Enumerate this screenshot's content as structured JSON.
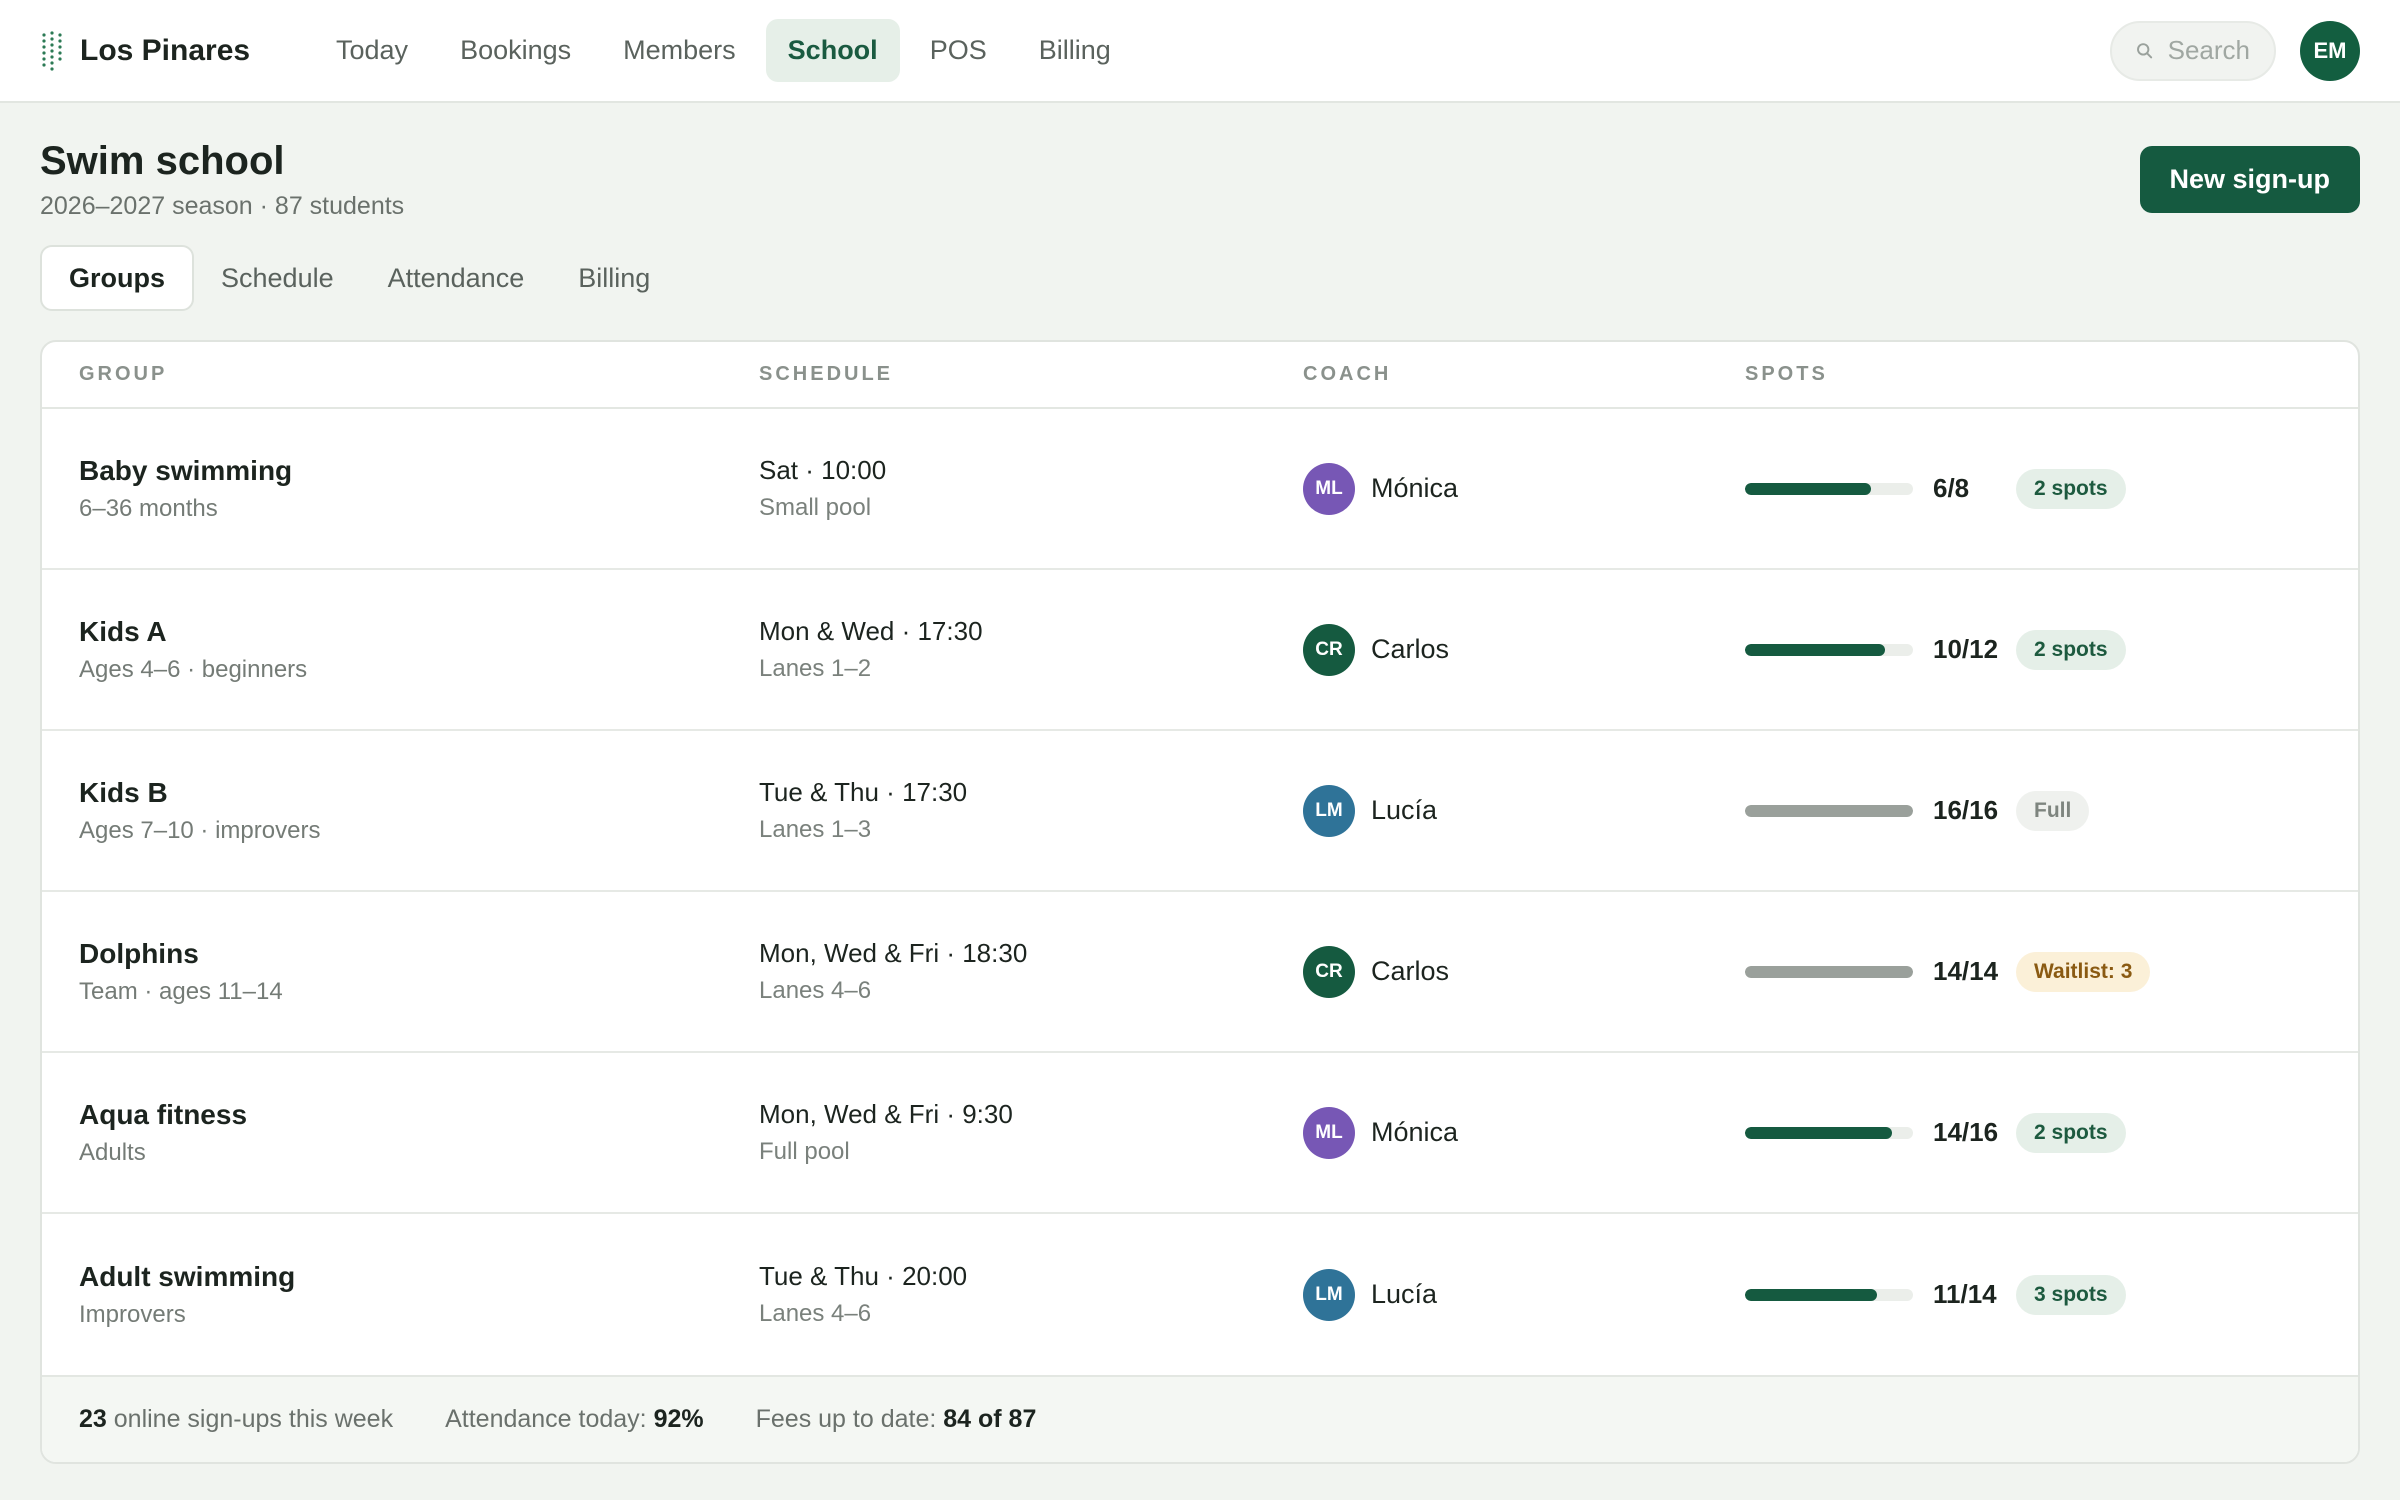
{
  "app": {
    "name": "Los Pinares"
  },
  "nav": {
    "items": [
      {
        "label": "Today"
      },
      {
        "label": "Bookings"
      },
      {
        "label": "Members"
      },
      {
        "label": "School",
        "active": true
      },
      {
        "label": "POS"
      },
      {
        "label": "Billing"
      }
    ]
  },
  "search": {
    "placeholder": "Search"
  },
  "user": {
    "initials": "EM"
  },
  "page": {
    "title": "Swim school",
    "subtitle": "2026–2027 season · 87 students",
    "new_button": "New sign-up"
  },
  "tabs": [
    {
      "label": "Groups",
      "active": true
    },
    {
      "label": "Schedule"
    },
    {
      "label": "Attendance"
    },
    {
      "label": "Billing"
    }
  ],
  "table": {
    "headers": {
      "group": "GROUP",
      "schedule": "SCHEDULE",
      "coach": "COACH",
      "spots": "SPOTS"
    },
    "rows": [
      {
        "name": "Baby swimming",
        "detail": "6–36 months",
        "schedule": "Sat · 10:00",
        "location": "Small pool",
        "coach": {
          "initials": "ML",
          "name": "Mónica",
          "color": "#7757b5"
        },
        "spots": "6/8",
        "fill": 0.75,
        "bar_color": "#155a40",
        "badge": "2 spots",
        "status": "open"
      },
      {
        "name": "Kids A",
        "detail": "Ages 4–6 · beginners",
        "schedule": "Mon & Wed · 17:30",
        "location": "Lanes 1–2",
        "coach": {
          "initials": "CR",
          "name": "Carlos",
          "color": "#155a40"
        },
        "spots": "10/12",
        "fill": 0.833,
        "bar_color": "#155a40",
        "badge": "2 spots",
        "status": "open"
      },
      {
        "name": "Kids B",
        "detail": "Ages 7–10 · improvers",
        "schedule": "Tue & Thu · 17:30",
        "location": "Lanes 1–3",
        "coach": {
          "initials": "LM",
          "name": "Lucía",
          "color": "#2f7398"
        },
        "spots": "16/16",
        "fill": 1.0,
        "bar_color": "#9aa09b",
        "badge": "Full",
        "status": "full"
      },
      {
        "name": "Dolphins",
        "detail": "Team · ages 11–14",
        "schedule": "Mon, Wed & Fri · 18:30",
        "location": "Lanes 4–6",
        "coach": {
          "initials": "CR",
          "name": "Carlos",
          "color": "#155a40"
        },
        "spots": "14/14",
        "fill": 1.0,
        "bar_color": "#9aa09b",
        "badge": "Waitlist: 3",
        "status": "wait"
      },
      {
        "name": "Aqua fitness",
        "detail": "Adults",
        "schedule": "Mon, Wed & Fri · 9:30",
        "location": "Full pool",
        "coach": {
          "initials": "ML",
          "name": "Mónica",
          "color": "#7757b5"
        },
        "spots": "14/16",
        "fill": 0.875,
        "bar_color": "#155a40",
        "badge": "2 spots",
        "status": "open"
      },
      {
        "name": "Adult swimming",
        "detail": "Improvers",
        "schedule": "Tue & Thu · 20:00",
        "location": "Lanes 4–6",
        "coach": {
          "initials": "LM",
          "name": "Lucía",
          "color": "#2f7398"
        },
        "spots": "11/14",
        "fill": 0.786,
        "bar_color": "#155a40",
        "badge": "3 spots",
        "status": "open"
      }
    ]
  },
  "summary": {
    "signups_value": "23",
    "signups_label": " online sign-ups this week",
    "attendance_label": "Attendance today: ",
    "attendance_value": "92%",
    "fees_label": "Fees up to date: ",
    "fees_value": "84 of 87"
  }
}
